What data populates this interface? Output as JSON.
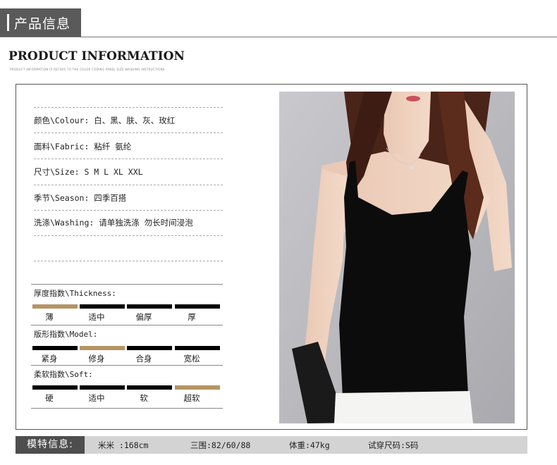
{
  "banner": {
    "title": "产品信息"
  },
  "heading": "PRODUCT INFORMATION",
  "subheading": "PRODUCT INFORMATION IS REFERS TO THE COLOR CODING PANEL SIZE WASHING INSTRUCTIONS",
  "info": [
    "颜色\\Colour: 白、黑、肤、灰、玫红",
    "面料\\Fabric: 粘纤 氨纶",
    "尺寸\\Size: S M L XL XXL",
    "季节\\Season: 四季百搭",
    "洗涤\\Washing:  请单独洗涤 勿长时间浸泡"
  ],
  "scales": {
    "thickness": {
      "title": "厚度指数\\Thickness:",
      "options": [
        "薄",
        "适中",
        "偏厚",
        "厚"
      ],
      "selected_index": 0
    },
    "model": {
      "title": "版形指数\\Model:",
      "options": [
        "紧身",
        "修身",
        "合身",
        "宽松"
      ],
      "selected_index": 1
    },
    "soft": {
      "title": "柔软指数\\Soft:",
      "options": [
        "硬",
        "适中",
        "软",
        "超软"
      ],
      "selected_index": 3
    }
  },
  "colors": {
    "highlight": "#b59464",
    "segment": "#000000",
    "banner": "#5a5a5a",
    "footer_bg": "#d3d3d3"
  },
  "footer": {
    "tag": "模特信息:",
    "height": "米米  :168cm",
    "measurements": "三围:82/60/88",
    "weight": "体重:47kg",
    "size": "试穿尺码:S码"
  }
}
